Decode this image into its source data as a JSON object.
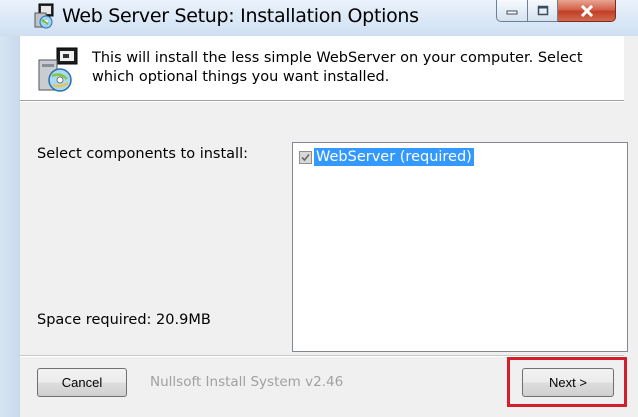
{
  "window": {
    "title": "Web Server Setup: Installation Options"
  },
  "header": {
    "description": "This will install the less simple WebServer on your computer. Select which optional things you want installed."
  },
  "components": {
    "label": "Select components to install:",
    "items": [
      {
        "label": "WebServer (required)",
        "checked": true,
        "disabled": true,
        "selected": true
      }
    ]
  },
  "space": {
    "label": "Space required: 20.9MB"
  },
  "footer": {
    "cancel_label": "Cancel",
    "brand": "Nullsoft Install System v2.46",
    "next_label": "Next >"
  },
  "colors": {
    "selection": "#3399ff",
    "highlight_box": "#d21f2b",
    "dialog_bg": "#f0f0f0"
  },
  "icons": {
    "app": "installer-icon",
    "header": "installer-cd-icon",
    "checkbox": "check-icon"
  }
}
